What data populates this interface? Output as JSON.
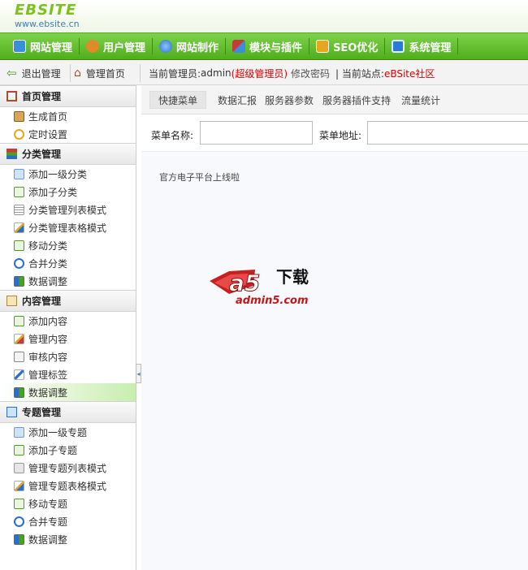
{
  "header": {
    "logo": "EBSITE",
    "logo_sub": "www.ebsite.cn"
  },
  "nav": [
    {
      "label": "网站管理",
      "icon": "website-icon",
      "color": "#3a8fd8"
    },
    {
      "label": "用户管理",
      "icon": "user-icon",
      "color": "#e08a2a"
    },
    {
      "label": "网站制作",
      "icon": "globe-icon",
      "color": "#2a6fc8"
    },
    {
      "label": "模块与插件",
      "icon": "module-icon",
      "color": "#c83a3a"
    },
    {
      "label": "SEO优化",
      "icon": "seo-icon",
      "color": "#e6a620"
    },
    {
      "label": "系统管理",
      "icon": "monitor-icon",
      "color": "#2a7ad8"
    }
  ],
  "toolbar": {
    "logout": "退出管理",
    "home": "管理首页",
    "admin_prefix": "当前管理员:",
    "admin_name": "admin",
    "admin_role": "(超级管理员)",
    "change_password": "修改密码",
    "site_prefix": "| 当前站点:",
    "site_name": "eBSite社区"
  },
  "sidebar": [
    {
      "title": "首页管理",
      "icon": "home-icon",
      "items": [
        {
          "label": "生成首页",
          "icon": "generate-icon"
        },
        {
          "label": "定时设置",
          "icon": "clock-icon"
        }
      ]
    },
    {
      "title": "分类管理",
      "icon": "category-icon",
      "items": [
        {
          "label": "添加一级分类",
          "icon": "add-icon"
        },
        {
          "label": "添加子分类",
          "icon": "add-sub-icon"
        },
        {
          "label": "分类管理列表模式",
          "icon": "list-icon"
        },
        {
          "label": "分类管理表格模式",
          "icon": "edit-icon"
        },
        {
          "label": "移动分类",
          "icon": "move-icon"
        },
        {
          "label": "合并分类",
          "icon": "merge-icon"
        },
        {
          "label": "数据调整",
          "icon": "data-icon"
        }
      ]
    },
    {
      "title": "内容管理",
      "icon": "content-icon",
      "items": [
        {
          "label": "添加内容",
          "icon": "add-icon"
        },
        {
          "label": "管理内容",
          "icon": "edit-icon"
        },
        {
          "label": "审核内容",
          "icon": "audit-icon"
        },
        {
          "label": "管理标签",
          "icon": "tag-icon"
        },
        {
          "label": "数据调整",
          "icon": "data-icon",
          "active": true
        }
      ]
    },
    {
      "title": "专题管理",
      "icon": "topic-icon",
      "items": [
        {
          "label": "添加一级专题",
          "icon": "add-icon"
        },
        {
          "label": "添加子专题",
          "icon": "add-sub-icon"
        },
        {
          "label": "管理专题列表模式",
          "icon": "list-icon"
        },
        {
          "label": "管理专题表格模式",
          "icon": "edit-icon"
        },
        {
          "label": "移动专题",
          "icon": "move-icon"
        },
        {
          "label": "合并专题",
          "icon": "merge-icon"
        },
        {
          "label": "数据调整",
          "icon": "data-icon"
        }
      ]
    }
  ],
  "tabs": [
    "快捷菜单",
    "数据汇报",
    "服务器参数",
    "服务器插件支持",
    "流量统计"
  ],
  "form": {
    "name_label": "菜单名称:",
    "url_label": "菜单地址:"
  },
  "notice": "官方电子平台上线啦",
  "ad": {
    "logo_text": "a5",
    "title": "下载",
    "site": "admin5.com"
  }
}
